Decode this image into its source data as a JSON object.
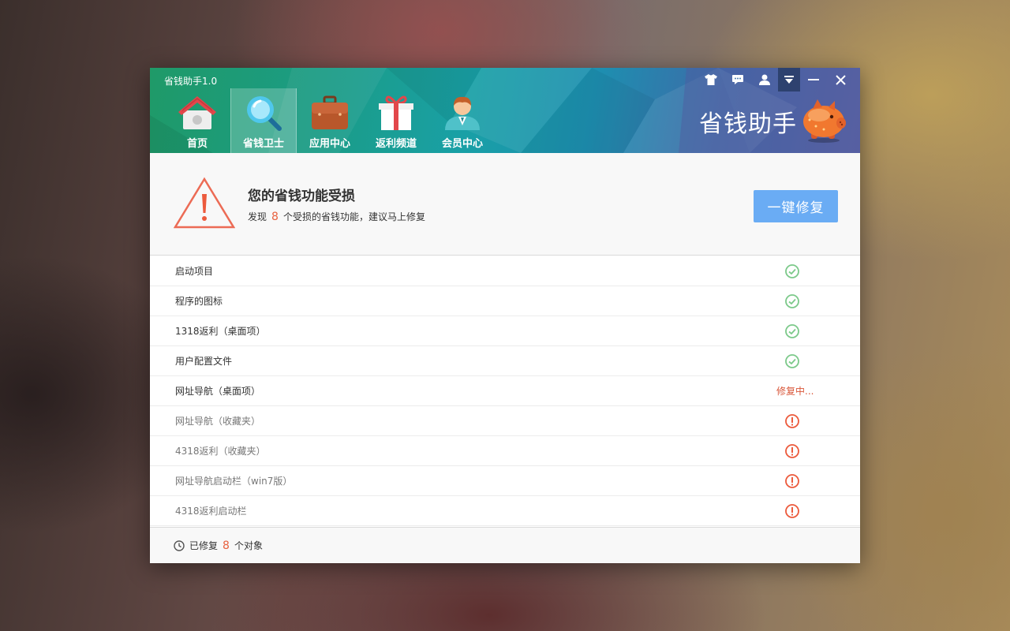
{
  "window": {
    "title": "省钱助手1.0",
    "brand_text": "省钱助手",
    "controls": [
      "skin-icon",
      "feedback-icon",
      "user-icon",
      "menu-dropdown-icon",
      "minimize-icon",
      "close-icon"
    ]
  },
  "nav": {
    "items": [
      {
        "label": "首页",
        "icon": "home-icon"
      },
      {
        "label": "省钱卫士",
        "icon": "magnifier-icon",
        "active": true
      },
      {
        "label": "应用中心",
        "icon": "briefcase-icon"
      },
      {
        "label": "返利频道",
        "icon": "gift-icon"
      },
      {
        "label": "会员中心",
        "icon": "member-avatar-icon"
      }
    ]
  },
  "alert": {
    "title": "您的省钱功能受损",
    "sub_prefix": "发现",
    "count": "8",
    "sub_suffix": "个受损的省钱功能，建议马上修复",
    "button": "一键修复"
  },
  "items": [
    {
      "label": "启动项目",
      "status": "ok"
    },
    {
      "label": "程序的图标",
      "status": "ok"
    },
    {
      "label": "1318返利（桌面项）",
      "status": "ok"
    },
    {
      "label": "用户配置文件",
      "status": "ok"
    },
    {
      "label": "网址导航（桌面项）",
      "status": "repairing",
      "status_text": "修复中..."
    },
    {
      "label": "网址导航（收藏夹）",
      "status": "warning"
    },
    {
      "label": "4318返利（收藏夹）",
      "status": "warning"
    },
    {
      "label": "网址导航启动栏（win7版）",
      "status": "warning"
    },
    {
      "label": "4318返利启动栏",
      "status": "warning"
    }
  ],
  "footer": {
    "prefix": "已修复",
    "count": "8",
    "suffix": "个对象"
  },
  "colors": {
    "accent_button": "#6aacf4",
    "ok_green": "#7cc98a",
    "warning_red": "#ec5a3c",
    "count_orange": "#e8613f"
  }
}
